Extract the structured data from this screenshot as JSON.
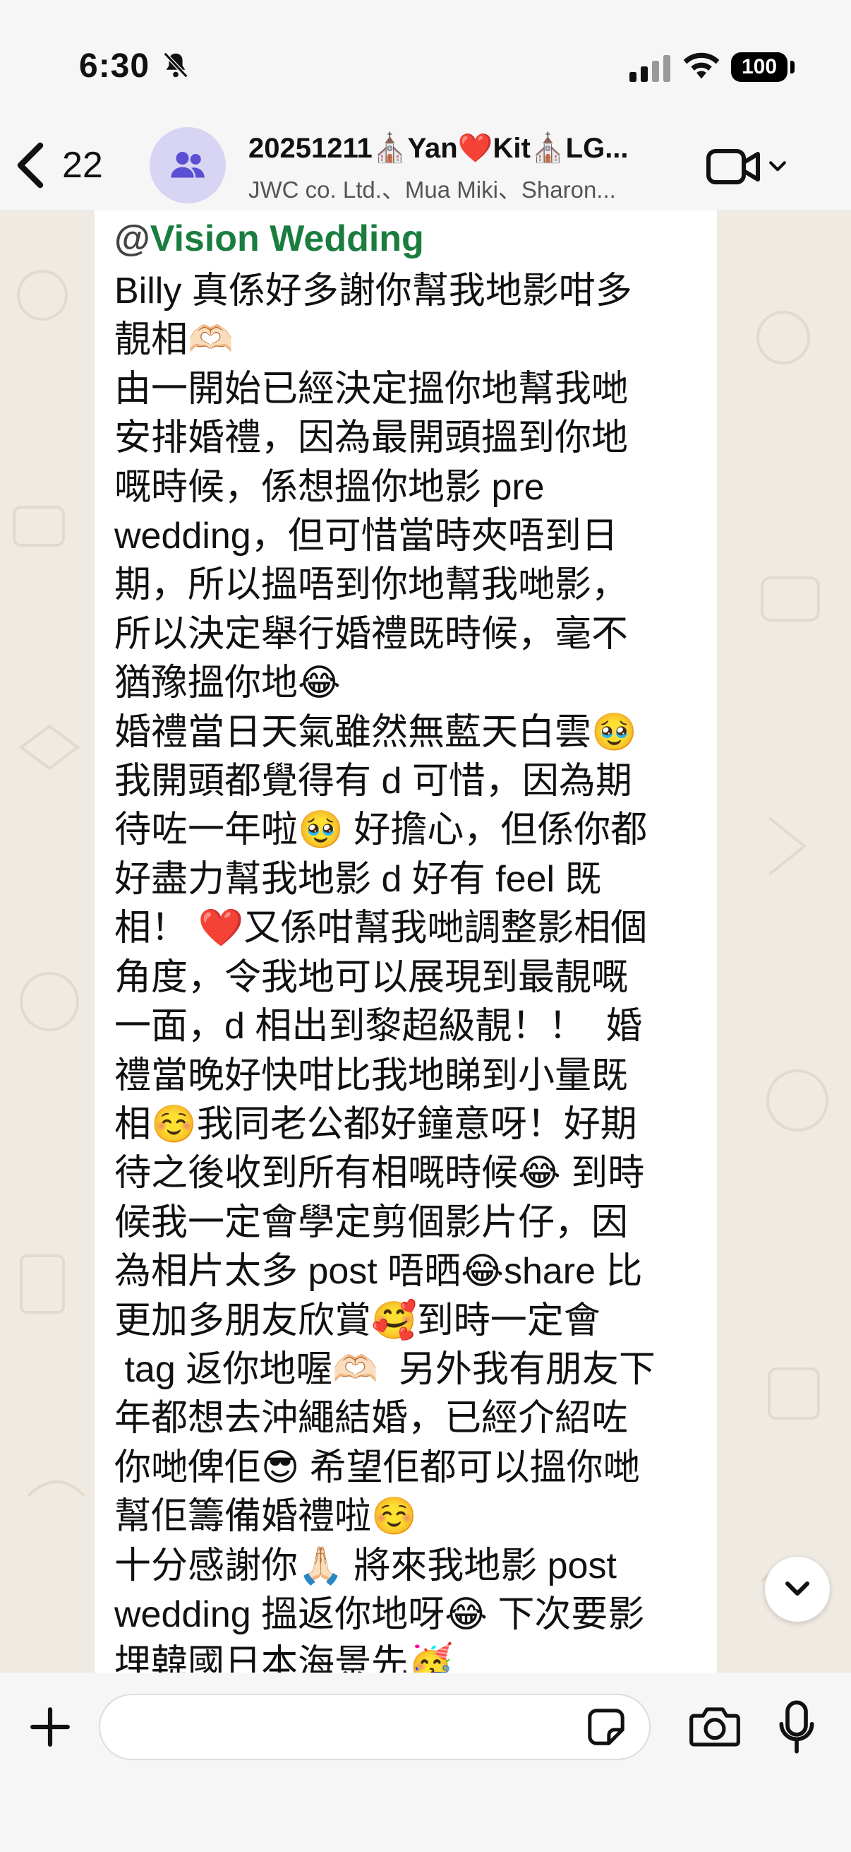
{
  "status": {
    "time": "6:30",
    "battery": "100"
  },
  "header": {
    "back_count": "22",
    "title": "20251211⛪Yan❤️Kit⛪LG...",
    "subtitle": "JWC co. Ltd.、Mua Miki、Sharon..."
  },
  "message": {
    "sender_at": "@",
    "sender": "Vision Wedding",
    "lines": [
      "Billy 真係好多謝你幫我地影咁多",
      "靚相🫶🏻",
      "由一開始已經決定搵你地幫我哋",
      "安排婚禮，因為最開頭搵到你地",
      "嘅時候，係想搵你地影 pre",
      "wedding，但可惜當時夾唔到日",
      "期，所以搵唔到你地幫我哋影，",
      "所以決定舉行婚禮既時候，毫不",
      "猶豫搵你地😂",
      "婚禮當日天氣雖然無藍天白雲🥹",
      "我開頭都覺得有 d 可惜，因為期",
      "待咗一年啦🥹 好擔心，但係你都",
      "好盡力幫我地影 d 好有 feel 既",
      "相！ ❤️又係咁幫我哋調整影相個",
      "角度，令我地可以展現到最靚嘅",
      "一面，d 相出到黎超級靚！！  婚",
      "禮當晚好快咁比我地睇到小量既",
      "相☺️我同老公都好鐘意呀！好期",
      "待之後收到所有相嘅時候😂 到時",
      "候我一定會學定剪個影片仔，因",
      "為相片太多 post 唔晒😂share 比",
      "更加多朋友欣賞🥰到時一定會",
      " tag 返你地喔🫶🏻  另外我有朋友下",
      "年都想去沖繩結婚，已經介紹咗",
      "你哋俾佢😎 希望佢都可以搵你哋",
      "幫佢籌備婚禮啦☺️",
      "十分感謝你🙏🏻 將來我地影 post",
      "wedding 搵返你地呀😂 下次要影",
      "埋韓國日本海景先🥳"
    ]
  },
  "input": {
    "placeholder": ""
  }
}
